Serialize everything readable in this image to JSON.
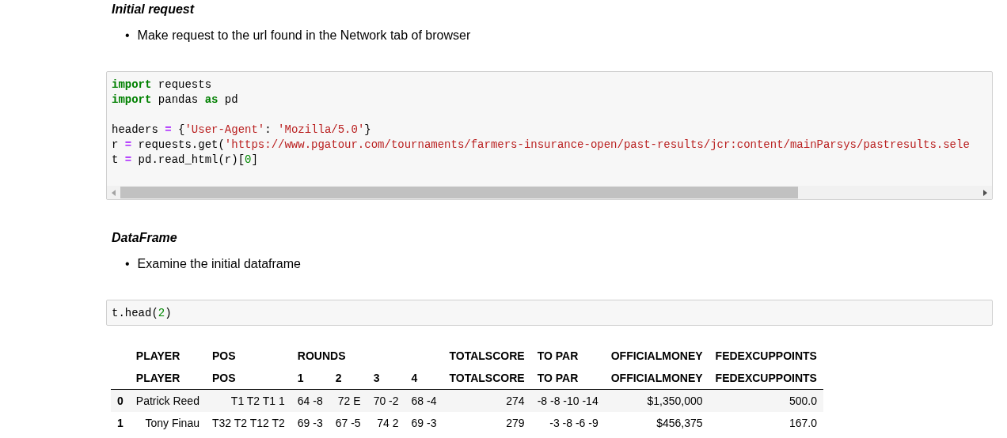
{
  "cells": [
    {
      "kind": "heading",
      "text": "Initial request"
    },
    {
      "kind": "bullet",
      "marker": "•",
      "text": "Make request to the url found in the Network tab of browser"
    },
    {
      "kind": "code",
      "scroll": true,
      "blocks": [
        [
          [
            {
              "text": "import",
              "kind": "kw"
            },
            {
              "text": " requests",
              "kind": "plain"
            }
          ],
          [
            {
              "text": "import",
              "kind": "kw"
            },
            {
              "text": " pandas ",
              "kind": "plain"
            },
            {
              "text": "as",
              "kind": "kw"
            },
            {
              "text": " pd",
              "kind": "plain"
            }
          ]
        ],
        [
          [
            {
              "text": "headers ",
              "kind": "plain"
            },
            {
              "text": "=",
              "kind": "op"
            },
            {
              "text": " {",
              "kind": "plain"
            },
            {
              "text": "'User-Agent'",
              "kind": "str"
            },
            {
              "text": ": ",
              "kind": "plain"
            },
            {
              "text": "'Mozilla/5.0'",
              "kind": "str"
            },
            {
              "text": "}",
              "kind": "plain"
            }
          ],
          [
            {
              "text": "r ",
              "kind": "plain"
            },
            {
              "text": "=",
              "kind": "op"
            },
            {
              "text": " requests.get(",
              "kind": "plain"
            },
            {
              "text": "'https://www.pgatour.com/tournaments/farmers-insurance-open/past-results/jcr:content/mainParsys/pastresults.sele",
              "kind": "str"
            }
          ],
          [
            {
              "text": "t ",
              "kind": "plain"
            },
            {
              "text": "=",
              "kind": "op"
            },
            {
              "text": " pd.read_html(r)[",
              "kind": "plain"
            },
            {
              "text": "0",
              "kind": "num"
            },
            {
              "text": "]",
              "kind": "plain"
            }
          ]
        ]
      ]
    },
    {
      "kind": "heading",
      "text": "DataFrame"
    },
    {
      "kind": "bullet",
      "marker": "•",
      "text": "Examine the initial dataframe"
    },
    {
      "kind": "code",
      "scroll": false,
      "blocks": [
        [
          [
            {
              "text": "t.head(",
              "kind": "plain"
            },
            {
              "text": "2",
              "kind": "num"
            },
            {
              "text": ")",
              "kind": "plain"
            }
          ]
        ]
      ]
    },
    {
      "kind": "table",
      "header_rows": [
        [
          "PLAYER",
          "POS",
          "ROUNDS",
          null,
          null,
          null,
          "TOTALSCORE",
          "TO PAR",
          "OFFICIALMONEY",
          "FEDEXCUPPOINTS"
        ],
        [
          "PLAYER",
          "POS",
          "1",
          "2",
          "3",
          "4",
          "TOTALSCORE",
          "TO PAR",
          "OFFICIALMONEY",
          "FEDEXCUPPOINTS"
        ]
      ],
      "rows": [
        {
          "index": "0",
          "cells": [
            "Patrick Reed",
            "T1 T2 T1 1",
            "64 -8",
            "72 E",
            "70 -2",
            "68 -4",
            "274",
            "-8 -8 -10 -14",
            "$1,350,000",
            "500.0"
          ]
        },
        {
          "index": "1",
          "cells": [
            "Tony Finau",
            "T32 T2 T12 T2",
            "69 -3",
            "67 -5",
            "74 2",
            "69 -3",
            "279",
            "-3 -8 -6 -9",
            "$456,375",
            "167.0"
          ]
        }
      ]
    }
  ]
}
